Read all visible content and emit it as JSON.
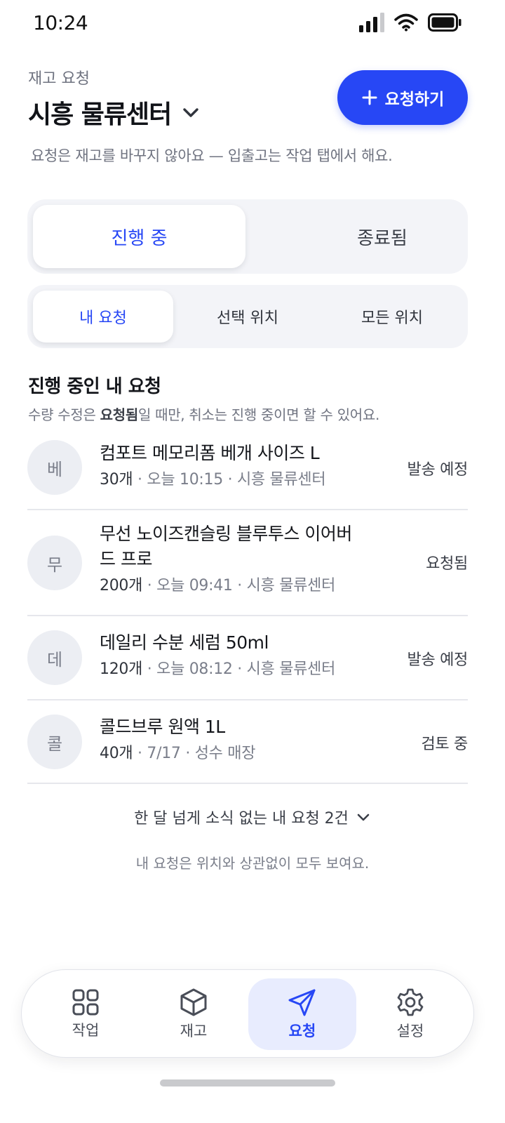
{
  "status_bar": {
    "time": "10:24"
  },
  "header": {
    "subtitle": "재고 요청",
    "title": "시흥 물류센터",
    "request_button": "요청하기",
    "notice": "요청은 재고를 바꾸지 않아요 — 입출고는 작업 탭에서 해요."
  },
  "segments": {
    "main": [
      {
        "label": "진행 중",
        "active": true
      },
      {
        "label": "종료됨",
        "active": false
      }
    ],
    "scope": [
      {
        "label": "내 요청",
        "active": true
      },
      {
        "label": "선택 위치",
        "active": false
      },
      {
        "label": "모든 위치",
        "active": false
      }
    ]
  },
  "section": {
    "title": "진행 중인 내 요청",
    "desc_prefix": "수량 수정은 ",
    "desc_bold": "요청됨",
    "desc_suffix": "일 때만, 취소는 진행 중이면 할 수 있어요."
  },
  "requests": [
    {
      "initial": "베",
      "name": "컴포트 메모리폼 베개 사이즈 L",
      "qty": "30개",
      "meta": " · 오늘 10:15 · 시흥 물류센터",
      "status": "발송 예정"
    },
    {
      "initial": "무",
      "name": "무선 노이즈캔슬링 블루투스 이어버드 프로",
      "qty": "200개",
      "meta": " · 오늘 09:41 · 시흥 물류센터",
      "status": "요청됨"
    },
    {
      "initial": "데",
      "name": "데일리 수분 세럼 50ml",
      "qty": "120개",
      "meta": " · 오늘 08:12 · 시흥 물류센터",
      "status": "발송 예정"
    },
    {
      "initial": "콜",
      "name": "콜드브루 원액 1L",
      "qty": "40개",
      "meta": " · 7/17 · 성수 매장",
      "status": "검토 중"
    }
  ],
  "stale_toggle": "한 달 넘게 소식 없는 내 요청 2건",
  "footer_note": "내 요청은 위치와 상관없이 모두 보여요.",
  "tabs": [
    {
      "label": "작업",
      "icon": "grid-icon",
      "active": false
    },
    {
      "label": "재고",
      "icon": "box-icon",
      "active": false
    },
    {
      "label": "요청",
      "icon": "send-icon",
      "active": true
    },
    {
      "label": "설정",
      "icon": "gear-icon",
      "active": false
    }
  ],
  "colors": {
    "accent": "#2747f5",
    "accent_soft": "#e8ecfe",
    "muted": "#6f7380"
  }
}
